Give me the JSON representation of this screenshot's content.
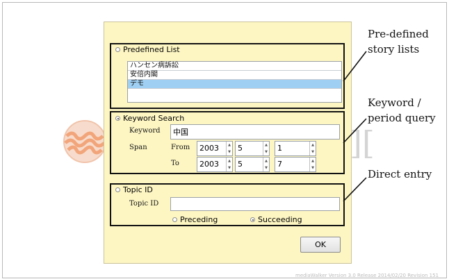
{
  "predefined": {
    "label": "Predefined List",
    "items": [
      "ハンセン病訴訟",
      "安倍内閣",
      "デモ"
    ],
    "selected_index": 2
  },
  "keyword_search": {
    "label": "Keyword Search",
    "keyword_label": "Keyword",
    "keyword_value": "中国",
    "span_label": "Span",
    "from_label": "From",
    "to_label": "To",
    "from": {
      "year": "2003",
      "month": "5",
      "day": "1"
    },
    "to": {
      "year": "2003",
      "month": "5",
      "day": "7"
    }
  },
  "topic": {
    "label": "Topic ID",
    "field_label": "Topic ID",
    "value": "",
    "preceding": "Preceding",
    "succeeding": "Succeeding"
  },
  "ok_label": "OK",
  "annotations": {
    "predefined": [
      "Pre-defined",
      "story lists"
    ],
    "keyword": [
      "Keyword /",
      "period query"
    ],
    "direct": "Direct entry"
  },
  "footer": "mediaWalker Version 3.0 Release 2014/02/20 Revision 151"
}
